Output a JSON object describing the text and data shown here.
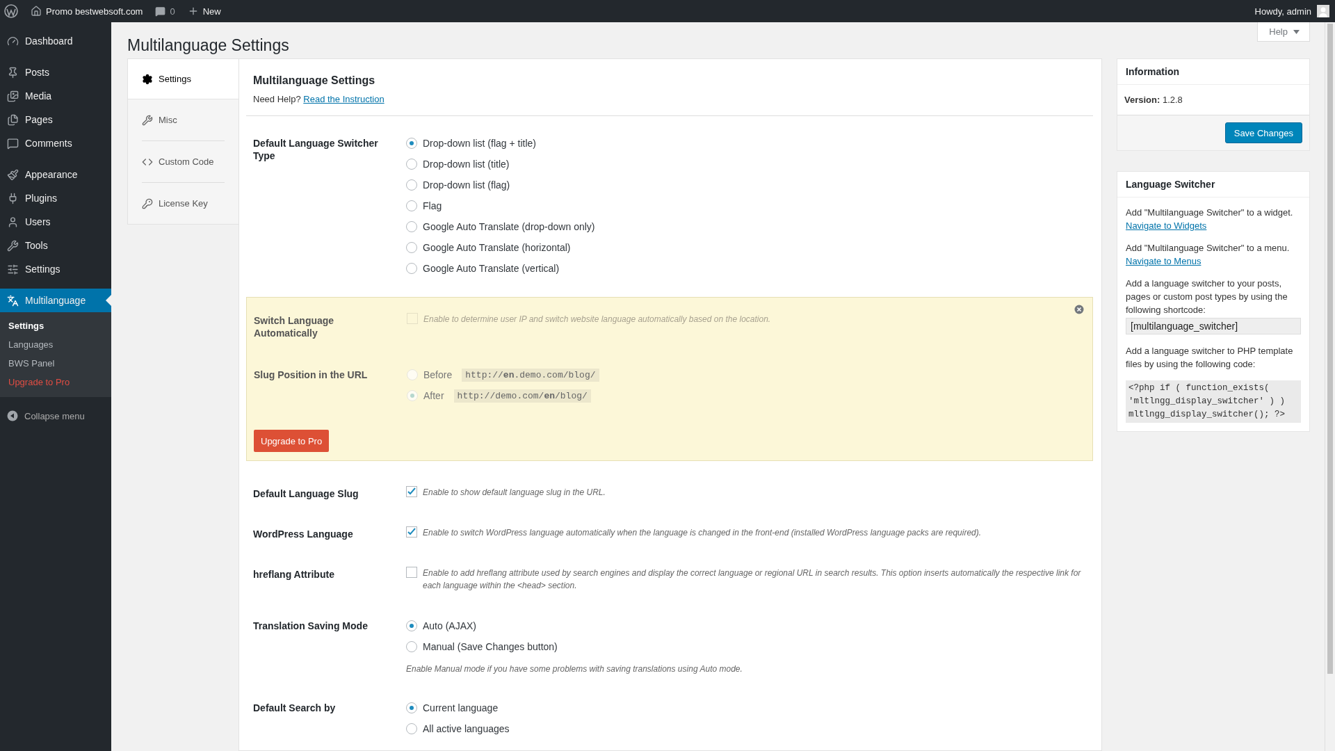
{
  "admin_bar": {
    "site": "Promo bestwebsoft.com",
    "comments": "0",
    "new": "New",
    "greeting": "Howdy, admin"
  },
  "menu_groups": [
    {
      "items": [
        {
          "label": "Dashboard",
          "selected": false
        }
      ]
    },
    {
      "items": [
        {
          "label": "Posts",
          "selected": false
        },
        {
          "label": "Media",
          "selected": false
        },
        {
          "label": "Pages",
          "selected": false
        },
        {
          "label": "Comments",
          "selected": false
        }
      ]
    },
    {
      "items": [
        {
          "label": "Appearance",
          "selected": false
        },
        {
          "label": "Plugins",
          "selected": false
        },
        {
          "label": "Users",
          "selected": false
        },
        {
          "label": "Tools",
          "selected": false
        },
        {
          "label": "Settings",
          "selected": false
        }
      ]
    },
    {
      "items": [
        {
          "label": "Multilanguage",
          "selected": true
        }
      ]
    }
  ],
  "submenu": [
    {
      "label": "Settings",
      "selected": true,
      "kind": "link"
    },
    {
      "label": "Languages",
      "selected": false,
      "kind": "link"
    },
    {
      "label": "BWS Panel",
      "selected": false,
      "kind": "link"
    },
    {
      "label": "Upgrade to Pro",
      "selected": false,
      "kind": "upgrade"
    }
  ],
  "collapse": "Collapse menu",
  "page_title": "Multilanguage Settings",
  "help_button": "Help",
  "tabs": [
    {
      "label": "Settings",
      "selected": true
    },
    {
      "label": "Misc",
      "selected": false
    },
    {
      "label": "Custom Code",
      "selected": false
    },
    {
      "label": "License Key",
      "selected": false
    }
  ],
  "content": {
    "heading": "Multilanguage Settings",
    "help_prefix": "Need Help?",
    "help_link": "Read the Instruction"
  },
  "settings": [
    {
      "kind": "radio",
      "label": "Default Language Switcher Type",
      "options": [
        {
          "label": "Drop-down list (flag + title)",
          "selected": true
        },
        {
          "label": "Drop-down list (title)",
          "selected": false
        },
        {
          "label": "Drop-down list (flag)",
          "selected": false
        },
        {
          "label": "Flag",
          "selected": false
        },
        {
          "label": "Google Auto Translate (drop-down only)",
          "selected": false
        },
        {
          "label": "Google Auto Translate (horizontal)",
          "selected": false
        },
        {
          "label": "Google Auto Translate (vertical)",
          "selected": false
        }
      ]
    }
  ],
  "pro_box": {
    "disabled": true,
    "fields": [
      {
        "kind": "checkbox",
        "label": "Switch Language Automatically",
        "checked": false,
        "description": "Enable to determine user IP and switch website language automatically based on the location."
      },
      {
        "kind": "radio",
        "label": "Slug Position in the URL",
        "options": [
          {
            "label": "Before",
            "code": "http://**en**.demo.com/blog/",
            "selected": false
          },
          {
            "label": "After",
            "code": "http://demo.com/**en**/blog/",
            "selected": true
          }
        ]
      }
    ],
    "button": "Upgrade to Pro"
  },
  "settings_more": [
    {
      "kind": "checkbox",
      "label": "Default Language Slug",
      "checked": true,
      "description": "Enable to show default language slug in the URL."
    },
    {
      "kind": "checkbox",
      "label": "WordPress Language",
      "checked": true,
      "description": "Enable to switch WordPress language automatically when the language is changed in the front-end (installed WordPress language packs are required)."
    },
    {
      "kind": "checkbox",
      "label": "hreflang Attribute",
      "checked": false,
      "description": "Enable to add hreflang attribute used by search engines and display the correct language or regional URL in search results. This option inserts automatically the respective link for each language within the <head> section."
    },
    {
      "kind": "radio",
      "label": "Translation Saving Mode",
      "options": [
        {
          "label": "Auto (AJAX)",
          "selected": true
        },
        {
          "label": "Manual (Save Changes button)",
          "selected": false
        }
      ],
      "note": "Enable Manual mode if you have some problems with saving translations using Auto mode."
    },
    {
      "kind": "radio",
      "label": "Default Search by",
      "options": [
        {
          "label": "Current language",
          "selected": true
        },
        {
          "label": "All active languages",
          "selected": false
        }
      ]
    }
  ],
  "info_box": {
    "title": "Information",
    "version": "**Version:** 1.2.8",
    "button": "Save Changes"
  },
  "switcher_box": {
    "title": "Language Switcher",
    "blocks": [
      {
        "text": "Add \"Multilanguage Switcher\" to a widget.",
        "link": "Navigate to Widgets"
      },
      {
        "text": "Add \"Multilanguage Switcher\" to a menu.",
        "link": "Navigate to Menus"
      }
    ],
    "shortcode_text": "Add a language switcher to your posts, pages or custom post types by using the following shortcode:",
    "shortcode": "[multilanguage_switcher]",
    "php_text": "Add a language switcher to PHP template files by using the following code:",
    "php_code": "<?php if ( function_exists( 'mltlngg_display_switcher' ) ) mltlngg_display_switcher(); ?>"
  }
}
